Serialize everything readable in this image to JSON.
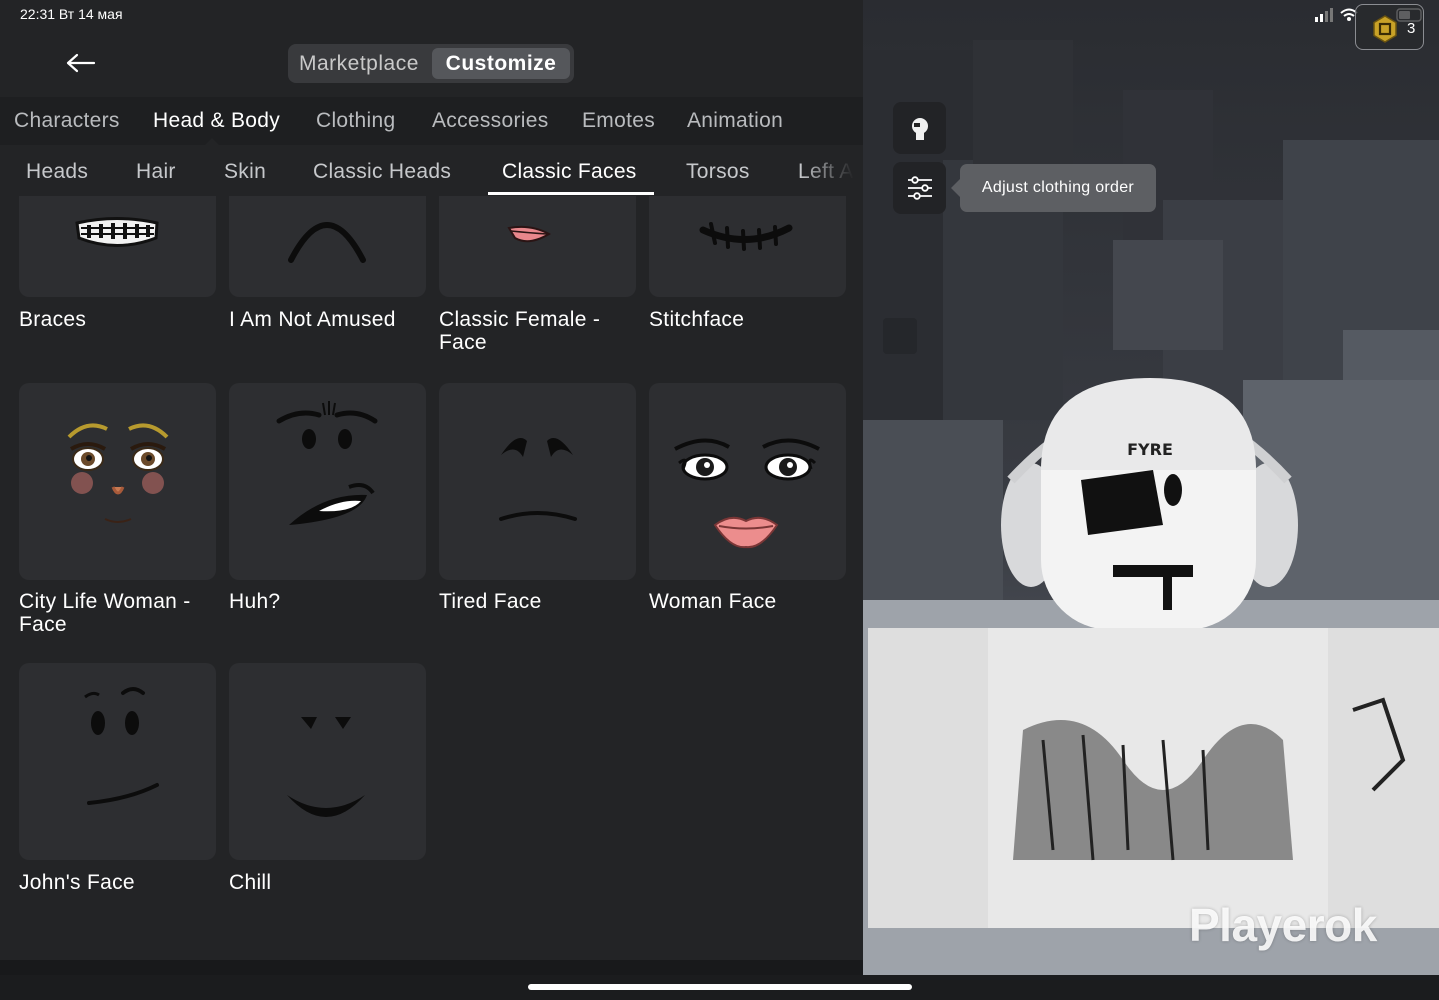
{
  "status_bar": {
    "time_date": "22:31  Вт 14 мая"
  },
  "header": {
    "modes": [
      {
        "label": "Marketplace",
        "active": false
      },
      {
        "label": "Customize",
        "active": true
      }
    ]
  },
  "categories": [
    {
      "label": "Characters",
      "active": false
    },
    {
      "label": "Head & Body",
      "active": true
    },
    {
      "label": "Clothing",
      "active": false
    },
    {
      "label": "Accessories",
      "active": false
    },
    {
      "label": "Emotes",
      "active": false
    },
    {
      "label": "Animation",
      "active": false
    }
  ],
  "subcategories": [
    {
      "label": "Heads",
      "active": false
    },
    {
      "label": "Hair",
      "active": false
    },
    {
      "label": "Skin",
      "active": false
    },
    {
      "label": "Classic Heads",
      "active": false
    },
    {
      "label": "Classic Faces",
      "active": true
    },
    {
      "label": "Torsos",
      "active": false
    },
    {
      "label": "Left A",
      "active": false
    }
  ],
  "items": [
    {
      "name": "Braces",
      "icon": "braces-face-icon"
    },
    {
      "name": "I Am Not Amused",
      "icon": "not-amused-face-icon"
    },
    {
      "name": "Classic Female - Face",
      "icon": "classic-female-face-icon"
    },
    {
      "name": "Stitchface",
      "icon": "stitchface-icon"
    },
    {
      "name": "City Life Woman - Face",
      "icon": "city-life-woman-face-icon"
    },
    {
      "name": "Huh?",
      "icon": "huh-face-icon"
    },
    {
      "name": "Tired Face",
      "icon": "tired-face-icon"
    },
    {
      "name": "Woman Face",
      "icon": "woman-face-icon"
    },
    {
      "name": "John's Face",
      "icon": "johns-face-icon"
    },
    {
      "name": "Chill",
      "icon": "chill-face-icon"
    }
  ],
  "viewport": {
    "tooltip": "Adjust clothing order",
    "avatar_cap_text": "FYRE",
    "robux_count": "3",
    "watermark": "Playerok"
  }
}
